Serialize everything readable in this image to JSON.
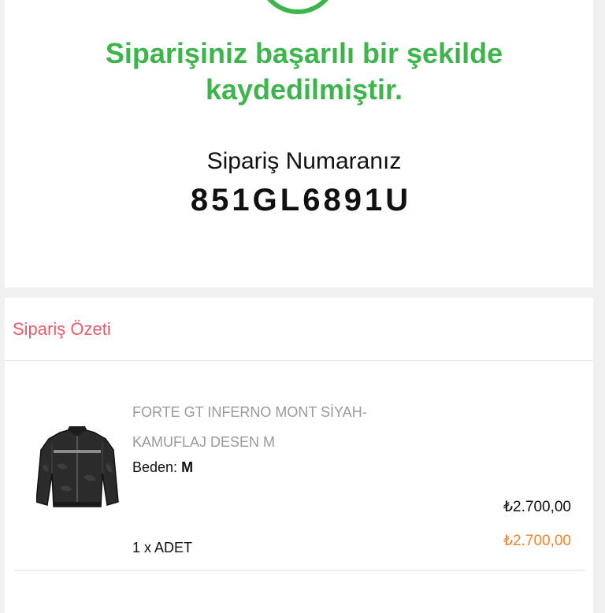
{
  "confirmation": {
    "icon": "check-circle-icon",
    "message": "Siparişiniz başarılı bir şekilde kaydedilmiştir.",
    "order_number_label": "Sipariş Numaranız",
    "order_number": "851GL6891U"
  },
  "summary": {
    "title": "Sipariş Özeti",
    "items": [
      {
        "image": "jacket-product-image",
        "name": "FORTE GT INFERNO MONT SİYAH-KAMUFLAJ DESEN M",
        "size_label": "Beden:",
        "size_value": "M",
        "price_original": "₺2.700,00",
        "price_final": "₺2.700,00",
        "quantity": "1 x ADET"
      }
    ]
  },
  "colors": {
    "success": "#3cb54a",
    "summary_title": "#ef5a6b",
    "price_final": "#f0852a"
  }
}
